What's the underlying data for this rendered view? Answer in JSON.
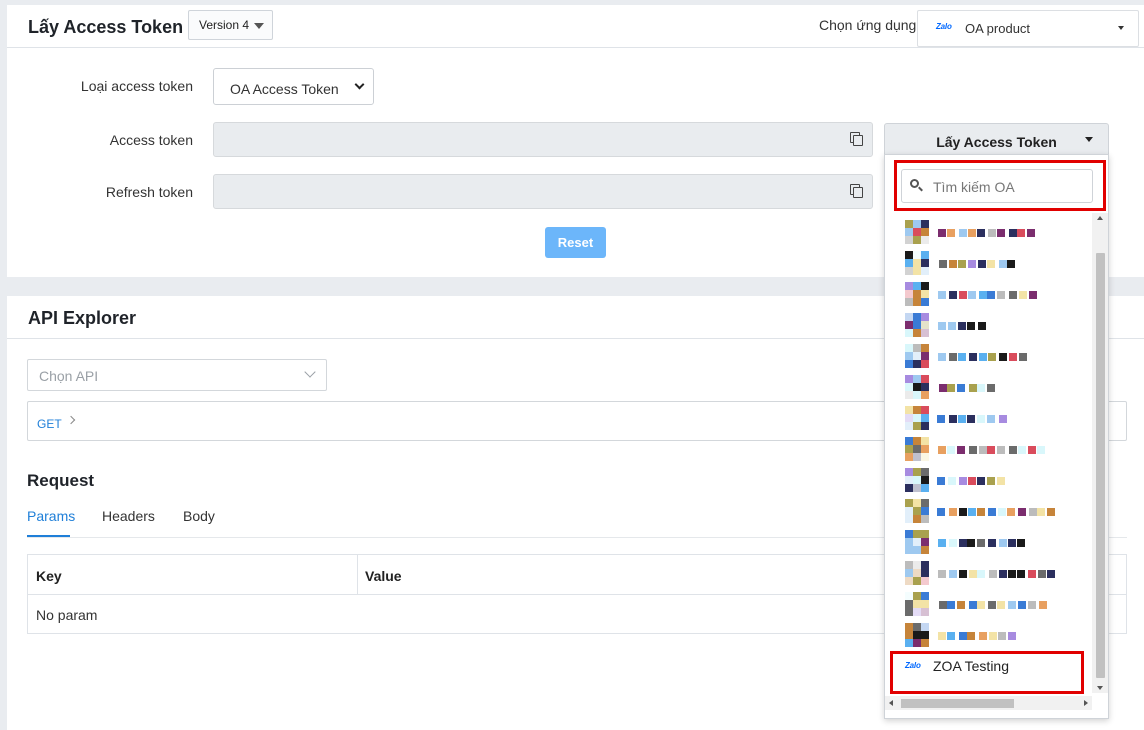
{
  "token_panel": {
    "title": "Lấy Access Token",
    "version_select": "Version 4",
    "app_label": "Chọn ứng dụng",
    "app_select": {
      "logo_text": "Zalo",
      "value": "OA product"
    },
    "token_type_label": "Loại access token",
    "token_type_value": "OA Access Token",
    "access_token_label": "Access token",
    "refresh_token_label": "Refresh token",
    "get_token_button": "Lấy Access Token",
    "reset_button": "Reset"
  },
  "oa_dropdown": {
    "search_placeholder": "Tìm kiếm OA",
    "items": [
      {
        "label": "",
        "redacted": true
      },
      {
        "label": "",
        "redacted": true
      },
      {
        "label": "",
        "redacted": true
      },
      {
        "label": "",
        "redacted": true
      },
      {
        "label": "",
        "redacted": true
      },
      {
        "label": "",
        "redacted": true
      },
      {
        "label": "",
        "redacted": true
      },
      {
        "label": "",
        "redacted": true
      },
      {
        "label": "",
        "redacted": true
      },
      {
        "label": "",
        "redacted": true
      },
      {
        "label": "",
        "redacted": true
      },
      {
        "label": "",
        "redacted": true
      },
      {
        "label": "",
        "redacted": true
      },
      {
        "label": "",
        "redacted": true
      }
    ],
    "last_item": {
      "logo_text": "Zalo",
      "label": "ZOA Testing"
    },
    "highlight_color": "#e10000"
  },
  "api_panel": {
    "title": "API Explorer",
    "api_select_placeholder": "Chọn API",
    "method": "GET",
    "request_title": "Request",
    "tabs": [
      "Params",
      "Headers",
      "Body"
    ],
    "active_tab": "Params",
    "table_headers": {
      "key": "Key",
      "value": "Value"
    },
    "empty_text": "No param"
  },
  "colors": {
    "accent": "#1f7fd8",
    "reset_button": "#6cb6fa",
    "page_bg": "#e9ecf0"
  },
  "pixel_palette": [
    "#3a7bd5",
    "#9ec9f0",
    "#7b2d6e",
    "#f3e3a6",
    "#c6843a",
    "#d9f7fb",
    "#2b2f5e",
    "#a9a14e",
    "#d94c5c",
    "#6b6b6b",
    "#bcbcbc",
    "#1a1a1a",
    "#a78be0",
    "#5ab0f0",
    "#e8a060"
  ]
}
